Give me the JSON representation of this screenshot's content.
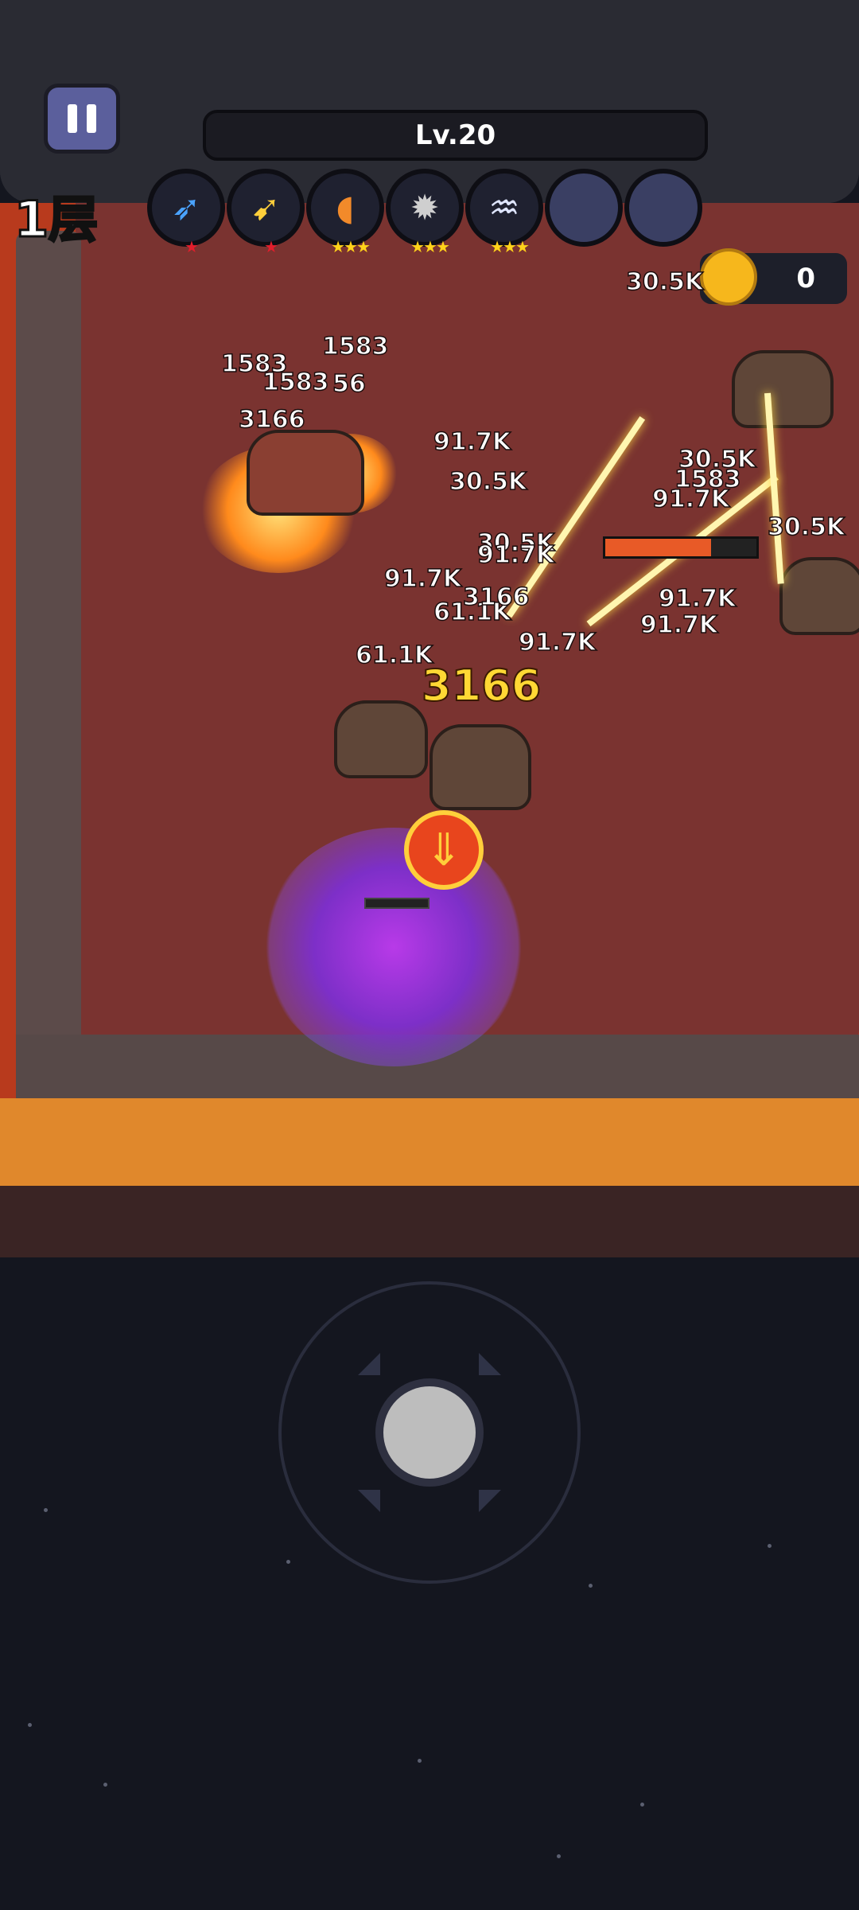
{
  "hud": {
    "floor_label": "1层",
    "level_label": "Lv.20",
    "coin_count": "0"
  },
  "skills": [
    {
      "icon": "rocket-icon",
      "stars": "★",
      "star_color": "red"
    },
    {
      "icon": "arrow-icon",
      "stars": "★",
      "star_color": "red"
    },
    {
      "icon": "boomerang-icon",
      "stars": "★★★",
      "star_color": "gold"
    },
    {
      "icon": "spiked-ball-icon",
      "stars": "★★★",
      "star_color": "gold"
    },
    {
      "icon": "tornado-icon",
      "stars": "★★★",
      "star_color": "gold"
    },
    {
      "icon": "empty-slot",
      "stars": "",
      "star_color": "gold"
    },
    {
      "icon": "empty-slot",
      "stars": "",
      "star_color": "gold"
    }
  ],
  "damage_numbers": [
    "1583",
    "1583",
    "1583",
    "56",
    "3166",
    "91.7K",
    "30.5K",
    "30.5K",
    "30.5K",
    "30.5K",
    "1583",
    "91.7K",
    "30.5K",
    "91.7K",
    "61.1K",
    "3166",
    "61.1K",
    "91.7K",
    "91.7K",
    "3166",
    "91.7K",
    "91.7K"
  ],
  "colors": {
    "arena_floor": "#7a3330",
    "lava": "#e0882c",
    "wall": "#5c4b4a",
    "coin": "#f6b71c",
    "hero_aura": "#b83ae8"
  },
  "boss_health": 0.7
}
